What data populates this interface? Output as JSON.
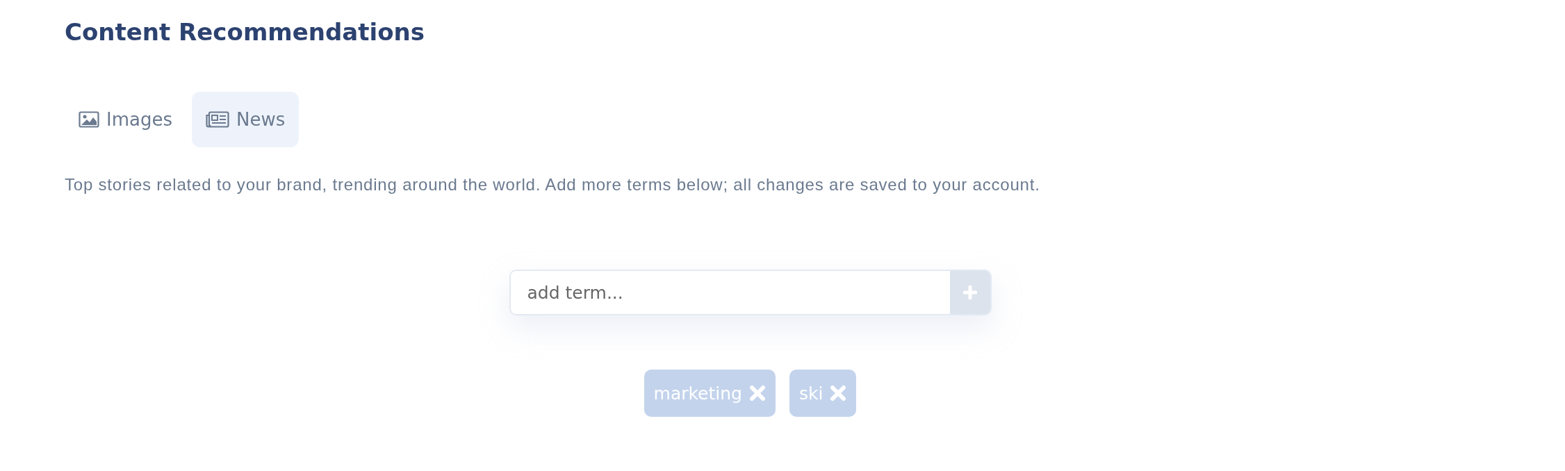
{
  "title": "Content Recommendations",
  "tabs": [
    {
      "label": "Images",
      "kind": "image",
      "selected": false
    },
    {
      "label": "News",
      "kind": "news",
      "selected": true
    }
  ],
  "description": "Top stories related to your brand, trending around the world. Add more terms below; all changes are saved to your account.",
  "term_input": {
    "placeholder": "add term..."
  },
  "terms": [
    "marketing",
    "ski"
  ]
}
